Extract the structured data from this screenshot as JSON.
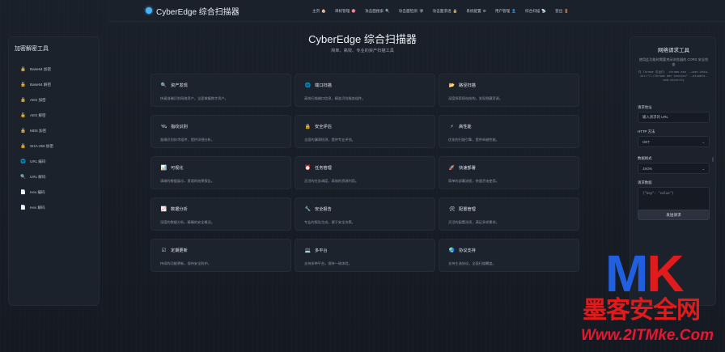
{
  "brand": {
    "title": "CyberEdge 综合扫描器",
    "accent": "#4ab3f4"
  },
  "nav": [
    {
      "label": "主页",
      "icon": "house-icon",
      "glyph": "🏠"
    },
    {
      "label": "目标管理",
      "icon": "target-icon",
      "glyph": "🎯"
    },
    {
      "label": "攻击面搜索",
      "icon": "search-icon",
      "glyph": "🔍"
    },
    {
      "label": "攻击面检测",
      "icon": "shield-icon",
      "glyph": "🛡"
    },
    {
      "label": "攻击面渗透",
      "icon": "lock-icon",
      "glyph": "🔒"
    },
    {
      "label": "系统配置",
      "icon": "gear-icon",
      "glyph": "⚙"
    },
    {
      "label": "用户管理",
      "icon": "user-icon",
      "glyph": "👤"
    },
    {
      "label": "综合扫描",
      "icon": "radar-icon",
      "glyph": "📡"
    },
    {
      "label": "登出",
      "icon": "door-icon",
      "glyph": "🚪"
    }
  ],
  "sidebar": {
    "title": "加密解密工具",
    "items": [
      {
        "label": "Base64 加密",
        "icon": "lock-icon",
        "glyph": "🔒"
      },
      {
        "label": "Base64 解密",
        "icon": "unlock-icon",
        "glyph": "🔓"
      },
      {
        "label": "AES 加密",
        "icon": "lock-icon",
        "glyph": "🔒"
      },
      {
        "label": "AES 解密",
        "icon": "unlock-icon",
        "glyph": "🔓"
      },
      {
        "label": "MD5 加密",
        "icon": "lock-icon",
        "glyph": "🔒"
      },
      {
        "label": "SHA-256 加密",
        "icon": "lock-icon",
        "glyph": "🔒"
      },
      {
        "label": "URL 编码",
        "icon": "globe-icon",
        "glyph": "🌐"
      },
      {
        "label": "URL 解码",
        "icon": "search-icon",
        "glyph": "🔍"
      },
      {
        "label": "Hex 编码",
        "icon": "document-icon",
        "glyph": "📄"
      },
      {
        "label": "Hex 解码",
        "icon": "document-icon",
        "glyph": "📄"
      }
    ]
  },
  "hero": {
    "title": "CyberEdge 综合扫描器",
    "subtitle": "简单、高效、专业的资产扫描工具"
  },
  "cards": [
    {
      "title": "资产发现",
      "desc": "快速准确识别网络资产，全面掌握数字资产。",
      "icon": "magnifier-icon",
      "glyph": "🔍"
    },
    {
      "title": "端口扫描",
      "desc": "高效扫描端口信息，精准识别服务组件。",
      "icon": "globe-icon",
      "glyph": "🌐"
    },
    {
      "title": "路径扫描",
      "desc": "深度探索网站结构，发现隐藏资源。",
      "icon": "folder-icon",
      "glyph": "📂"
    },
    {
      "title": "指纹识别",
      "desc": "准确识别技术组件，提供详细分析。",
      "icon": "satellite-icon",
      "glyph": "🛰"
    },
    {
      "title": "安全评估",
      "desc": "全面的漏洞检测，提供专业评估。",
      "icon": "lock-icon",
      "glyph": "🔒"
    },
    {
      "title": "高性能",
      "desc": "优化的扫描引擎，提供卓越性能。",
      "icon": "lightning-icon",
      "glyph": "⚡"
    },
    {
      "title": "可视化",
      "desc": "清晰的数据展示，直观的结果报告。",
      "icon": "bar-chart-icon",
      "glyph": "📊"
    },
    {
      "title": "任务管理",
      "desc": "灵活的任务调度，高效的资源利用。",
      "icon": "alarm-clock-icon",
      "glyph": "⏰"
    },
    {
      "title": "快速部署",
      "desc": "简单的部署流程，快速开始使用。",
      "icon": "rocket-icon",
      "glyph": "🚀"
    },
    {
      "title": "数据分析",
      "desc": "深度的数据分析，精确的安全概况。",
      "icon": "trend-chart-icon",
      "glyph": "📈"
    },
    {
      "title": "安全报告",
      "desc": "专业的报告生成，便于安全决策。",
      "icon": "wrench-icon",
      "glyph": "🔧"
    },
    {
      "title": "配置管理",
      "desc": "灵活的配置选项，满足多样需求。",
      "icon": "tools-icon",
      "glyph": "🛠"
    },
    {
      "title": "定期更新",
      "desc": "持续的功能更新，保持安全防护。",
      "icon": "checkbox-icon",
      "glyph": "☑"
    },
    {
      "title": "多平台",
      "desc": "支持多种平台，保持一致体验。",
      "icon": "laptop-icon",
      "glyph": "💻"
    },
    {
      "title": "协议支持",
      "desc": "支持主流协议，全面扫描覆盖。",
      "icon": "earth-icon",
      "glyph": "🌏"
    }
  ],
  "request_panel": {
    "title": "网络请求工具",
    "desc": "使用此功能时需要关闭浏览器的 CORS 安全检查",
    "code": "在 Chrome 中运行： chrome.exe --user-data-dir=\"C:/Chrome dev session\" --disable-web-security",
    "url_label": "请求地址",
    "url_placeholder": "输入请求的 URL",
    "method_label": "HTTP 方法",
    "method_value": "GET",
    "format_label": "数据格式",
    "format_value": "JSON",
    "body_label": "请求数据",
    "body_placeholder": "{\"key\": \"value\"}",
    "send_label": "发送请求"
  },
  "watermark": {
    "logo_letters": "MK",
    "site_name": "墨客安全网",
    "url": "Www.2ITMke.Com"
  }
}
